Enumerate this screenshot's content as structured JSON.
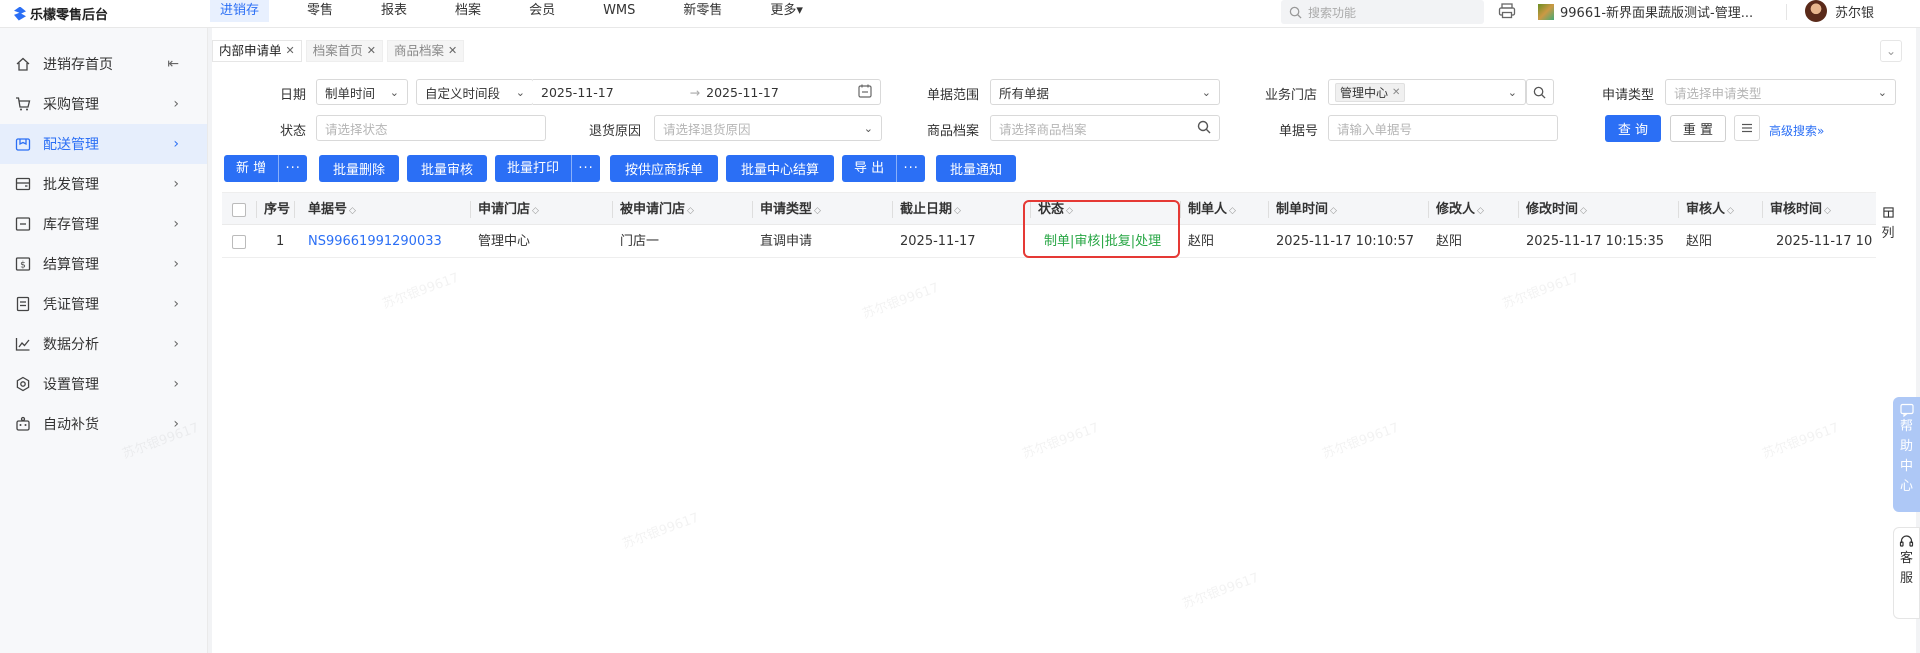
{
  "app": {
    "title": "乐檬零售后台"
  },
  "topnav": {
    "items": [
      "进销存",
      "零售",
      "报表",
      "档案",
      "会员",
      "WMS",
      "新零售",
      "更多▾"
    ],
    "active_index": 0,
    "search_placeholder": "搜索功能",
    "store_name": "99661-新界面果蔬版测试-管理...",
    "user_name": "苏尔银"
  },
  "sidebar": {
    "items": [
      {
        "label": "进销存首页",
        "icon": "home-icon"
      },
      {
        "label": "采购管理",
        "icon": "cart-icon"
      },
      {
        "label": "配送管理",
        "icon": "delivery-icon"
      },
      {
        "label": "批发管理",
        "icon": "wholesale-icon"
      },
      {
        "label": "库存管理",
        "icon": "inventory-icon"
      },
      {
        "label": "结算管理",
        "icon": "settlement-icon"
      },
      {
        "label": "凭证管理",
        "icon": "voucher-icon"
      },
      {
        "label": "数据分析",
        "icon": "analytics-icon"
      },
      {
        "label": "设置管理",
        "icon": "settings-icon"
      },
      {
        "label": "自动补货",
        "icon": "auto-replenish-icon"
      }
    ],
    "active_index": 2
  },
  "tabs": [
    {
      "label": "内部申请单",
      "active": true
    },
    {
      "label": "档案首页",
      "active": false
    },
    {
      "label": "商品档案",
      "active": false
    }
  ],
  "filters": {
    "date_label": "日期",
    "date_type": "制单时间",
    "date_range_type": "自定义时间段",
    "date_start": "2025-11-17",
    "date_sep": "→",
    "date_end": "2025-11-17",
    "scope_label": "单据范围",
    "scope_value": "所有单据",
    "store_label": "业务门店",
    "store_tag": "管理中心",
    "apply_type_label": "申请类型",
    "apply_type_placeholder": "请选择申请类型",
    "status_label": "状态",
    "status_placeholder": "请选择状态",
    "return_label": "退货原因",
    "return_placeholder": "请选择退货原因",
    "product_label": "商品档案",
    "product_placeholder": "请选择商品档案",
    "doc_no_label": "单据号",
    "doc_no_placeholder": "请输入单据号",
    "query_button": "查 询",
    "reset_button": "重 置",
    "advanced_search": "高级搜索»"
  },
  "toolbar": {
    "add": "新 增",
    "more": "···",
    "batch_delete": "批量删除",
    "batch_audit": "批量审核",
    "batch_print": "批量打印",
    "split_by_supplier": "按供应商拆单",
    "batch_center_settle": "批量中心结算",
    "export": "导 出",
    "batch_notify": "批量通知"
  },
  "table": {
    "columns": [
      "序号",
      "单据号",
      "申请门店",
      "被申请门店",
      "申请类型",
      "截止日期",
      "状态",
      "制单人",
      "制单时间",
      "修改人",
      "修改时间",
      "审核人",
      "审核时间"
    ],
    "rows": [
      {
        "index": "1",
        "doc_no": "NS99661991290033",
        "apply_store": "管理中心",
        "target_store": "门店一",
        "apply_type": "直调申请",
        "deadline": "2025-11-17",
        "status": "制单|审核|批复|处理",
        "creator": "赵阳",
        "create_time": "2025-11-17 10:10:57",
        "modifier": "赵阳",
        "modify_time": "2025-11-17 10:15:35",
        "auditor": "赵阳",
        "audit_time": "2025-11-17 10"
      }
    ],
    "column_setting": "列"
  },
  "float": {
    "help": [
      "帮",
      "助",
      "中",
      "心"
    ],
    "service": [
      "客",
      "服"
    ]
  },
  "watermark": "苏尔银99617",
  "colors": {
    "primary": "#2b6ff5",
    "status_green": "#27a644",
    "highlight": "#e53935"
  }
}
